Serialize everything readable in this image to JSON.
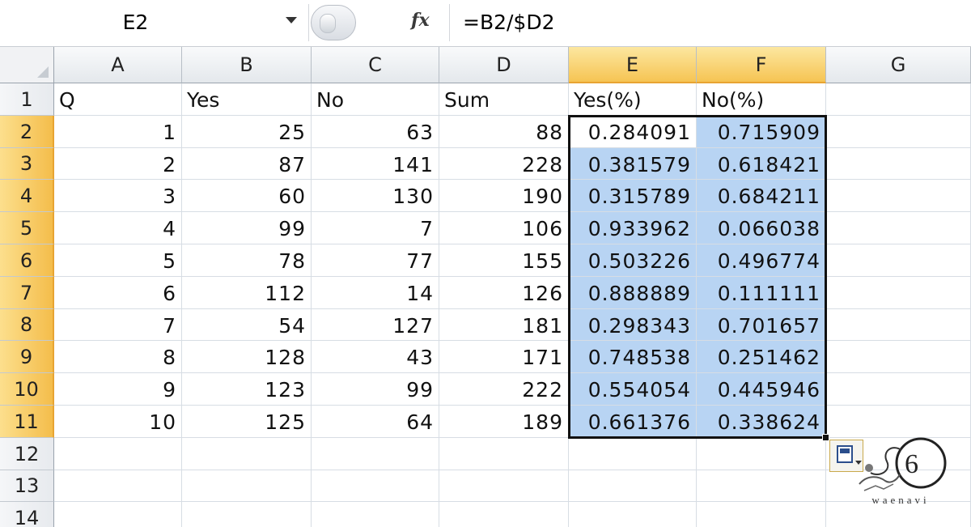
{
  "formula_bar": {
    "name_box": "E2",
    "fx_label": "fx",
    "formula": "=B2/$D2"
  },
  "columns": [
    "A",
    "B",
    "C",
    "D",
    "E",
    "F",
    "G"
  ],
  "selected_columns": [
    "E",
    "F"
  ],
  "rows": [
    "1",
    "2",
    "3",
    "4",
    "5",
    "6",
    "7",
    "8",
    "9",
    "10",
    "11",
    "12",
    "13",
    "14"
  ],
  "selected_rows": [
    "2",
    "3",
    "4",
    "5",
    "6",
    "7",
    "8",
    "9",
    "10",
    "11"
  ],
  "headers": [
    "Q",
    "Yes",
    "No",
    "Sum",
    "Yes(%)",
    "No(%)"
  ],
  "table": [
    [
      "1",
      "25",
      "63",
      "88",
      "0.284091",
      "0.715909"
    ],
    [
      "2",
      "87",
      "141",
      "228",
      "0.381579",
      "0.618421"
    ],
    [
      "3",
      "60",
      "130",
      "190",
      "0.315789",
      "0.684211"
    ],
    [
      "4",
      "99",
      "7",
      "106",
      "0.933962",
      "0.066038"
    ],
    [
      "5",
      "78",
      "77",
      "155",
      "0.503226",
      "0.496774"
    ],
    [
      "6",
      "112",
      "14",
      "126",
      "0.888889",
      "0.111111"
    ],
    [
      "7",
      "54",
      "127",
      "181",
      "0.298343",
      "0.701657"
    ],
    [
      "8",
      "128",
      "43",
      "171",
      "0.748538",
      "0.251462"
    ],
    [
      "9",
      "123",
      "99",
      "222",
      "0.554054",
      "0.445946"
    ],
    [
      "10",
      "125",
      "64",
      "189",
      "0.661376",
      "0.338624"
    ]
  ],
  "selection": {
    "active_cell": "E2",
    "range": "E2:F11"
  },
  "colors": {
    "selection_fill": "#b8d4f3",
    "header_highlight": "#f6c453",
    "selection_border": "#111111"
  },
  "watermark": {
    "text": "waenavi"
  }
}
